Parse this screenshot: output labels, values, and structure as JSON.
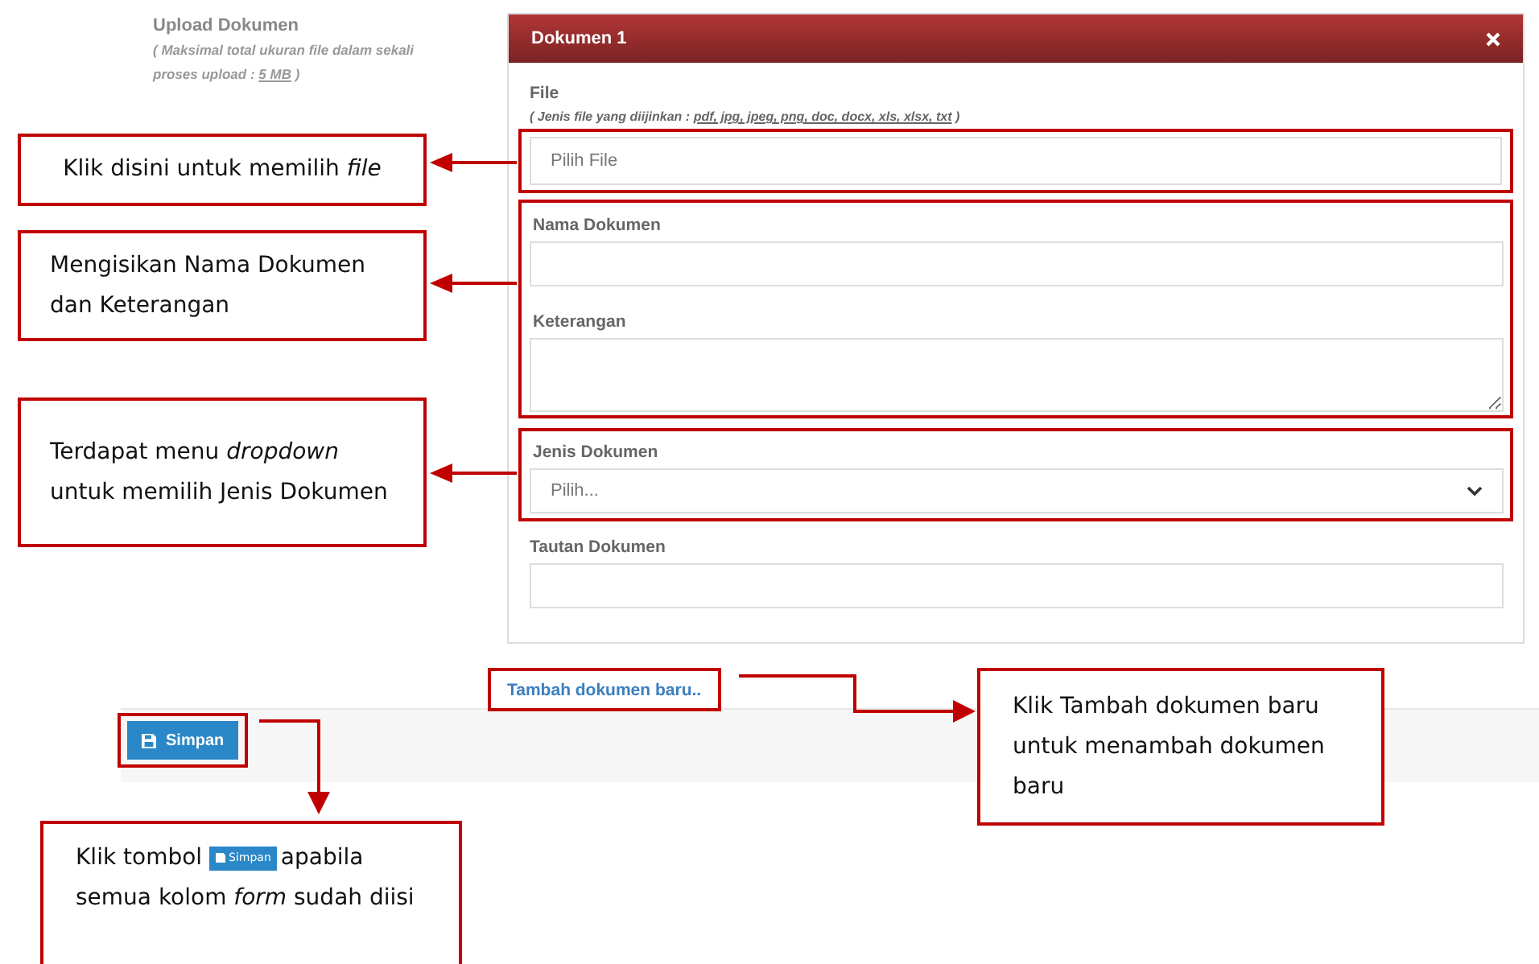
{
  "upload": {
    "label": "Upload Dokumen",
    "note": "( Maksimal total ukuran file dalam sekali proses upload : ",
    "note_link": "5 MB",
    "note_end": " )"
  },
  "panel": {
    "title": "Dokumen 1",
    "fields": [
      {
        "kind": "file",
        "label": "File",
        "hint": "( Jenis file yang diijinkan : ",
        "hint_link": "pdf, jpg, jpeg, png, doc, docx, xls, xlsx, txt",
        "hint_end": " )",
        "placeholder": "Pilih File"
      },
      {
        "kind": "text",
        "label": "Nama Dokumen"
      },
      {
        "kind": "textarea",
        "label": "Keterangan"
      },
      {
        "kind": "select",
        "label": "Jenis Dokumen",
        "value": "Pilih..."
      },
      {
        "kind": "text",
        "label": "Tautan Dokumen"
      }
    ]
  },
  "add_link": "Tambah dokumen baru..",
  "save_button": "Simpan",
  "callouts": [
    {
      "text": "Klik disini untuk memilih *file*"
    },
    {
      "text": "Mengisikan Nama Dokumen dan Keterangan"
    },
    {
      "text": "Terdapat menu *dropdown* untuk memilih Jenis Dokumen"
    },
    {
      "text": "Klik Tambah dokumen baru untuk menambah dokumen baru"
    },
    {
      "text": "Klik tombol ",
      "button": "Simpan",
      "text_end": "apabila semua kolom *form* sudah diisi"
    }
  ]
}
